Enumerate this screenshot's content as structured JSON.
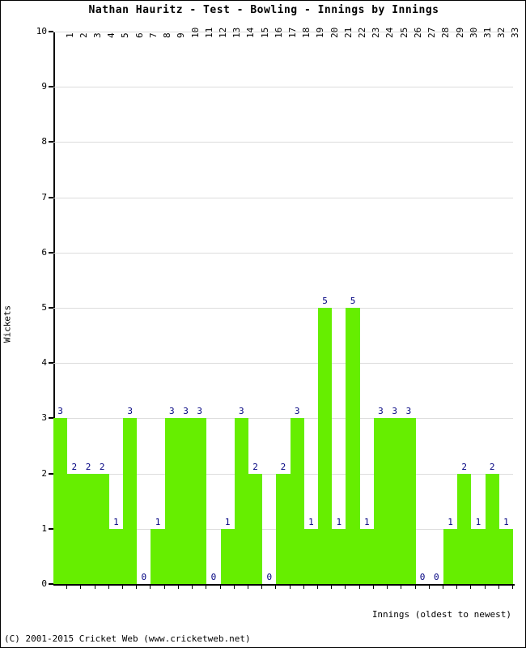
{
  "chart_data": {
    "type": "bar",
    "title": "Nathan Hauritz - Test - Bowling - Innings by Innings",
    "xlabel": "Innings (oldest to newest)",
    "ylabel": "Wickets",
    "ylim": [
      0,
      10
    ],
    "ytick_labels": [
      "0",
      "1",
      "2",
      "3",
      "4",
      "5",
      "6",
      "7",
      "8",
      "9",
      "10"
    ],
    "grid": true,
    "legend": "none",
    "bar_color": "#66ee00",
    "value_label_color": "#000080",
    "categories": [
      "1",
      "2",
      "3",
      "4",
      "5",
      "6",
      "7",
      "8",
      "9",
      "10",
      "11",
      "12",
      "13",
      "14",
      "15",
      "16",
      "17",
      "18",
      "19",
      "20",
      "21",
      "22",
      "23",
      "24",
      "25",
      "26",
      "27",
      "28",
      "29",
      "30",
      "31",
      "32",
      "33"
    ],
    "values": [
      3,
      2,
      2,
      2,
      1,
      3,
      0,
      1,
      3,
      3,
      3,
      0,
      1,
      3,
      2,
      0,
      2,
      3,
      1,
      5,
      1,
      5,
      1,
      3,
      3,
      3,
      0,
      0,
      1,
      2,
      1,
      2,
      1
    ],
    "data_labels": [
      "3",
      "2",
      "2",
      "2",
      "1",
      "3",
      "0",
      "1",
      "3",
      "3",
      "3",
      "0",
      "1",
      "3",
      "2",
      "0",
      "2",
      "3",
      "1",
      "5",
      "1",
      "5",
      "1",
      "3",
      "3",
      "3",
      "0",
      "0",
      "1",
      "2",
      "1",
      "2",
      "1"
    ]
  },
  "footer": {
    "copyright": "(C) 2001-2015 Cricket Web (www.cricketweb.net)"
  }
}
